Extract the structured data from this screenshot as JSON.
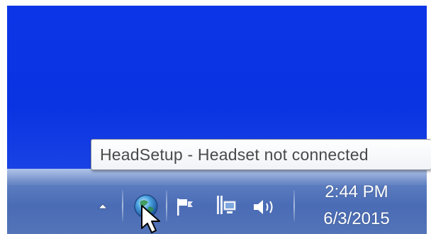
{
  "desktop": {
    "background_color": "#0b35e6"
  },
  "tooltip": {
    "text": "HeadSetup - Headset not connected"
  },
  "taskbar": {
    "tray": {
      "show_hidden_icon": "up-arrow-icon",
      "icons": [
        {
          "name": "headsetup-globe-icon"
        },
        {
          "name": "action-center-flag-icon"
        },
        {
          "name": "network-icon"
        },
        {
          "name": "volume-icon"
        }
      ]
    },
    "clock": {
      "time": "2:44 PM",
      "date": "6/3/2015"
    }
  }
}
